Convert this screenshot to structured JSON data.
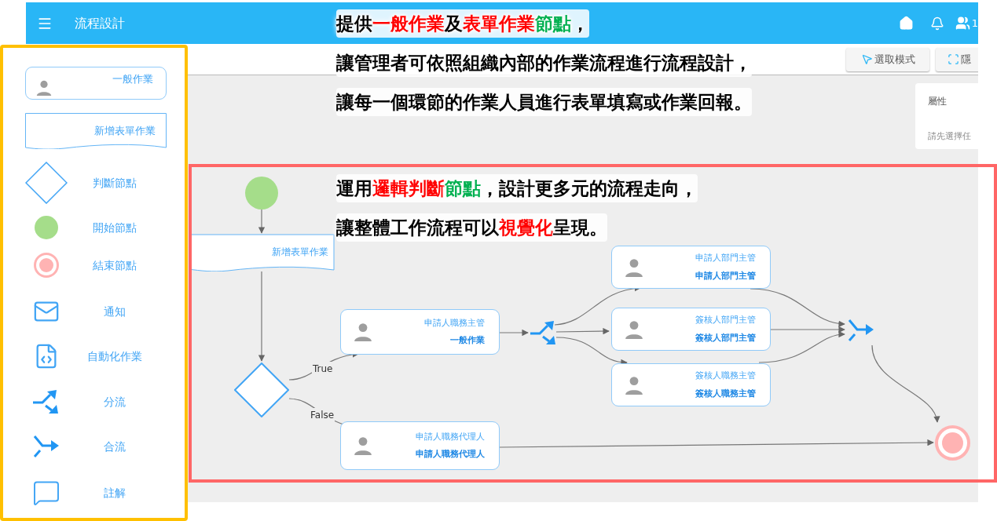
{
  "app_bar": {
    "title": "流程設計",
    "user_count": "1"
  },
  "toolbar": {
    "buttons": [
      {
        "kind": "select",
        "label": "選取模式"
      },
      {
        "kind": "hide",
        "label": "隱"
      }
    ]
  },
  "properties_panel": {
    "title": "屬性",
    "hint": "請先選擇任"
  },
  "palette": [
    {
      "kind": "task",
      "label": "一般作業"
    },
    {
      "kind": "form",
      "label": "新增表單作業"
    },
    {
      "kind": "decision",
      "label": "判斷節點"
    },
    {
      "kind": "start",
      "label": "開始節點"
    },
    {
      "kind": "end",
      "label": "結束節點"
    },
    {
      "kind": "notify",
      "label": "通知"
    },
    {
      "kind": "automation",
      "label": "自動化作業"
    },
    {
      "kind": "split",
      "label": "分流"
    },
    {
      "kind": "join",
      "label": "合流"
    },
    {
      "kind": "note",
      "label": "註解"
    }
  ],
  "diagram": {
    "nodes": [
      {
        "kind": "start"
      },
      {
        "kind": "form",
        "label": "新增表單作業"
      },
      {
        "kind": "decision"
      },
      {
        "kind": "task",
        "title": "申請人職務主管",
        "subtitle": "一般作業"
      },
      {
        "kind": "split"
      },
      {
        "kind": "task",
        "title": "申請人部門主管",
        "subtitle": "申請人部門主管"
      },
      {
        "kind": "task",
        "title": "簽核人部門主管",
        "subtitle": "簽核人部門主管"
      },
      {
        "kind": "task",
        "title": "簽核人職務主管",
        "subtitle": "簽核人職務主管"
      },
      {
        "kind": "join"
      },
      {
        "kind": "task",
        "title": "申請人職務代理人",
        "subtitle": "申請人職務代理人"
      },
      {
        "kind": "end"
      }
    ],
    "edge_labels": [
      "True",
      "False"
    ]
  },
  "annotations": [
    {
      "lines": [
        [
          {
            "text": "提供",
            "color": "#000000"
          },
          {
            "text": "一般作業",
            "color": "#ff0000"
          },
          {
            "text": "及",
            "color": "#000000"
          },
          {
            "text": "表單作業",
            "color": "#ff0000"
          },
          {
            "text": "節點",
            "color": "#00b050"
          },
          {
            "text": "，",
            "color": "#000000"
          }
        ],
        [
          {
            "text": "讓管理者可依照組織內部的作業流程進行流程設計，",
            "color": "#000000"
          }
        ],
        [
          {
            "text": "讓每一個環節的作業人員進行表單填寫或作業回報。",
            "color": "#000000"
          }
        ]
      ]
    },
    {
      "lines": [
        [
          {
            "text": "運用",
            "color": "#000000"
          },
          {
            "text": "邏輯判斷",
            "color": "#ff0000"
          },
          {
            "text": "節點",
            "color": "#00b050"
          },
          {
            "text": "，設計更多元的流程走向，",
            "color": "#000000"
          }
        ],
        [
          {
            "text": "讓整體工作流程可以",
            "color": "#000000"
          },
          {
            "text": "視覺化",
            "color": "#ff0000"
          },
          {
            "text": "呈現。",
            "color": "#000000"
          }
        ]
      ]
    }
  ]
}
